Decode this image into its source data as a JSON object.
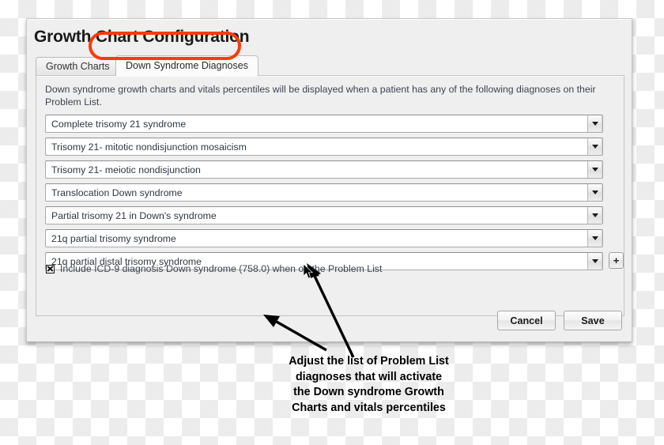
{
  "dialog": {
    "title": "Growth Chart Configuration"
  },
  "tabs": [
    {
      "label": "Growth Charts",
      "active": false
    },
    {
      "label": "Down Syndrome Diagnoses",
      "active": true
    }
  ],
  "content": {
    "description": "Down syndrome growth charts and vitals percentiles will be displayed when a patient has any of the following diagnoses on their Problem List.",
    "diagnoses": [
      "Complete trisomy 21 syndrome",
      "Trisomy 21- mitotic nondisjunction mosaicism",
      "Trisomy 21- meiotic nondisjunction",
      "Translocation Down syndrome",
      "Partial trisomy 21 in Down's syndrome",
      "21q partial trisomy syndrome",
      "21q partial distal trisomy syndrome"
    ],
    "add_row_label": "+",
    "include_icd9": {
      "checked": true,
      "label": "Include ICD-9 diagnosis Down syndrome (758.0) when on the Problem List"
    }
  },
  "footer": {
    "cancel_label": "Cancel",
    "save_label": "Save"
  },
  "annotation": {
    "lines": [
      "Adjust the list of Problem List",
      "diagnoses that will activate",
      "the Down syndrome Growth",
      "Charts and vitals percentiles"
    ],
    "highlight_color": "#f63c0d",
    "arrow_color": "#000000"
  }
}
